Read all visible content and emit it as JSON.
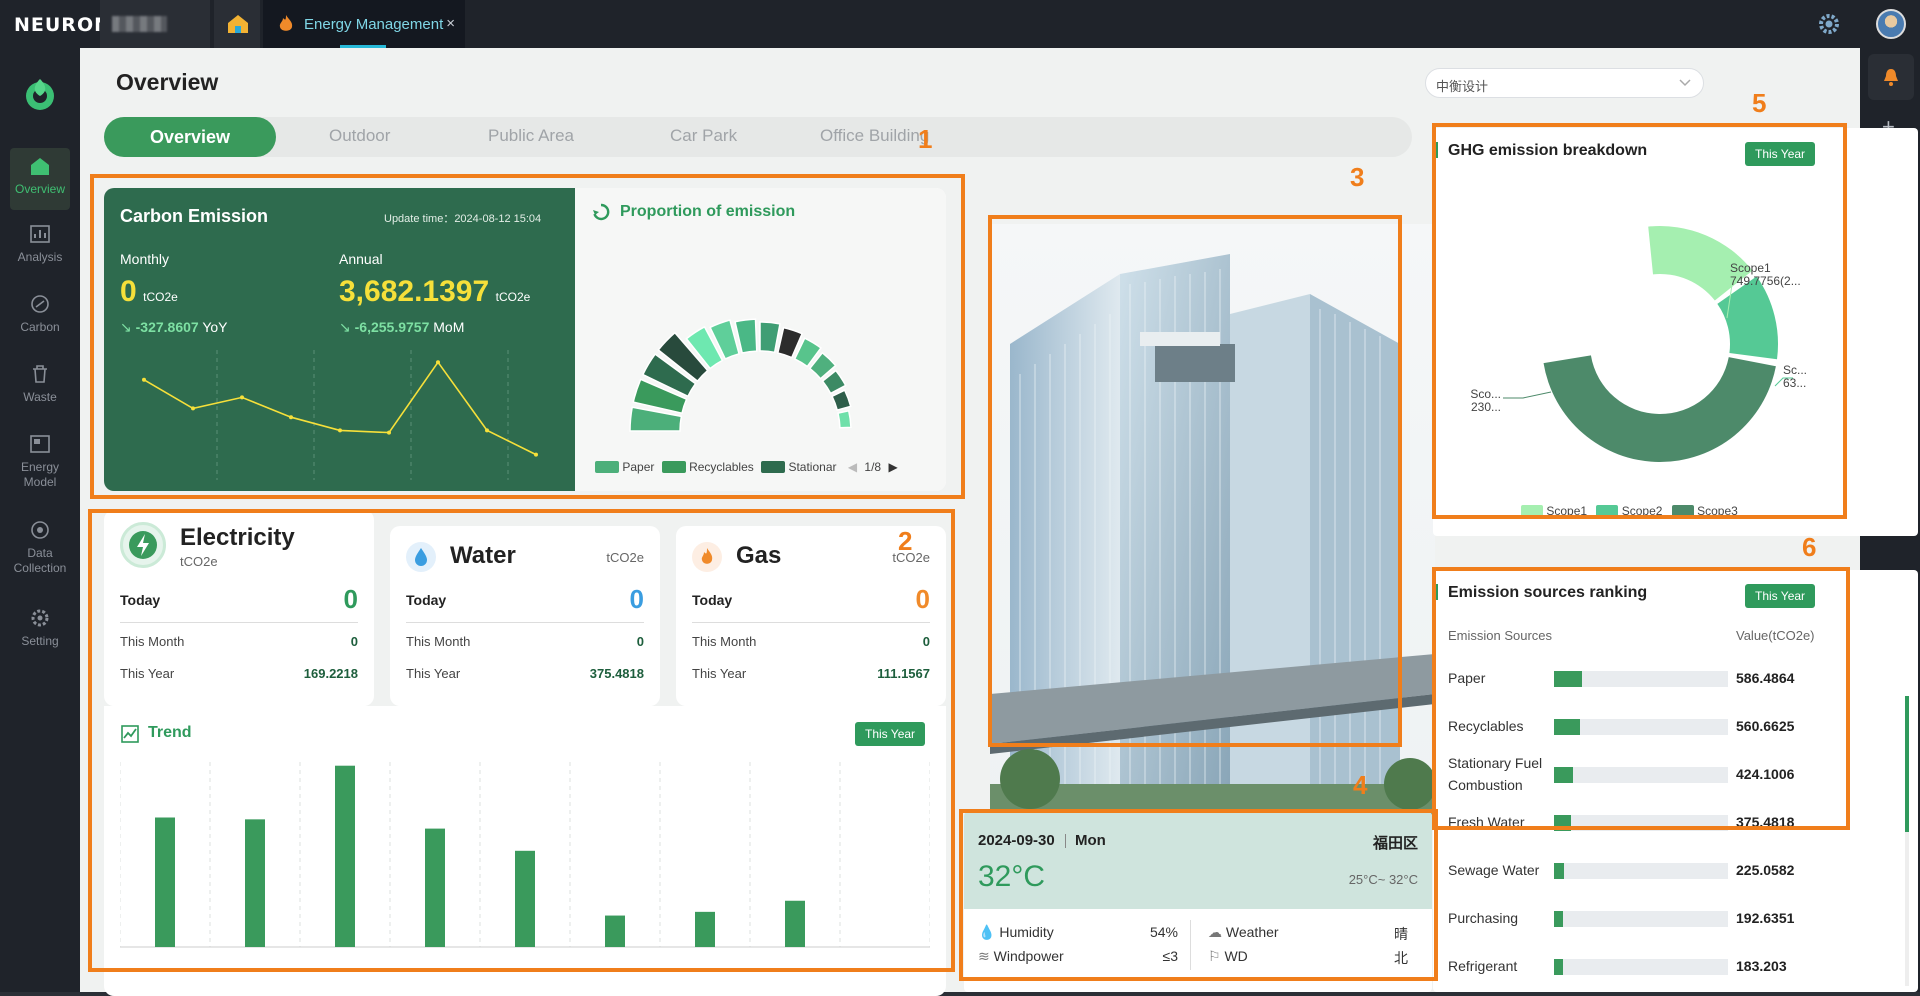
{
  "app": {
    "logo": "NEURON",
    "tab_title": "Energy Management",
    "tab_close": "×"
  },
  "sidebar": {
    "items": [
      {
        "label": "Overview",
        "icon": "home-icon"
      },
      {
        "label": "Analysis",
        "icon": "analysis-icon"
      },
      {
        "label": "Carbon",
        "icon": "carbon-icon"
      },
      {
        "label": "Waste",
        "icon": "waste-icon"
      },
      {
        "label": "Energy Model",
        "icon": "energy-model-icon"
      },
      {
        "label": "Data Collection",
        "icon": "data-collection-icon"
      },
      {
        "label": "Setting",
        "icon": "setting-icon"
      }
    ]
  },
  "page": {
    "title": "Overview",
    "project_select": "中衡设计"
  },
  "nav_tabs": [
    "Overview",
    "Outdoor",
    "Public Area",
    "Car Park",
    "Office Building"
  ],
  "carbon": {
    "title": "Carbon Emission",
    "update_label": "Update time：",
    "update_time": "2024-08-12 15:04",
    "monthly_label": "Monthly",
    "monthly_value": "0",
    "unit": "tCO2e",
    "monthly_change": "-327.8607",
    "monthly_change_label": "YoY",
    "annual_label": "Annual",
    "annual_value": "3,682.1397",
    "annual_change": "-6,255.9757",
    "annual_change_label": "MoM",
    "sparkline": [
      820,
      560,
      660,
      480,
      360,
      340,
      980,
      360,
      140
    ]
  },
  "proportion": {
    "title": "Proportion of emission",
    "legend": [
      "Paper",
      "Recyclables",
      "Stationar"
    ],
    "page": "1/8",
    "colors": [
      "#4caf7a",
      "#3a9a5c",
      "#2e6b4e",
      "#284a3c",
      "#6ee8b0",
      "#5fcf9a",
      "#4ab886",
      "#3f9e74",
      "#2c2c2c",
      "#58c48c",
      "#4fb07e",
      "#3c8a64",
      "#2e5e4a",
      "#6fe0aa"
    ]
  },
  "electricity": {
    "title": "Electricity",
    "unit": "tCO2e",
    "today_label": "Today",
    "today": "0",
    "month_label": "This Month",
    "month": "0",
    "year_label": "This Year",
    "year": "169.2218"
  },
  "water": {
    "title": "Water",
    "unit": "tCO2e",
    "today_label": "Today",
    "today": "0",
    "month_label": "This Month",
    "month": "0",
    "year_label": "This Year",
    "year": "375.4818"
  },
  "gas": {
    "title": "Gas",
    "unit": "tCO2e",
    "today_label": "Today",
    "today": "0",
    "month_label": "This Month",
    "month": "0",
    "year_label": "This Year",
    "year": "111.1567"
  },
  "trend": {
    "title": "Trend",
    "period": "This Year",
    "values": [
      70,
      69,
      98,
      64,
      52,
      17,
      19,
      25
    ]
  },
  "weather": {
    "date": "2024-09-30",
    "weekday": "Mon",
    "district": "福田区",
    "temp": "32°C",
    "range": "25°C~ 32°C",
    "humidity_label": "Humidity",
    "humidity": "54%",
    "weather_label": "Weather",
    "weather": "晴",
    "wind_label": "Windpower",
    "wind": "≤3",
    "wd_label": "WD",
    "wd": "北"
  },
  "ghg": {
    "title": "GHG emission breakdown",
    "period": "This Year",
    "labels": {
      "scope1_a": "Scope1",
      "scope1_b": "749.7756(2...",
      "scope2_a": "Sc...",
      "scope2_b": "63...",
      "scope3_a": "Sco...",
      "scope3_b": "230..."
    },
    "legend": [
      "Scope1",
      "Scope2",
      "Scope3"
    ],
    "colors": [
      "#a5efb0",
      "#55c995",
      "#4d8a6a"
    ]
  },
  "ranking": {
    "title": "Emission sources ranking",
    "period": "This Year",
    "col_source": "Emission Sources",
    "col_value": "Value(tCO2e)",
    "rows": [
      {
        "name": "Paper",
        "value": "586.4864",
        "pct": 0.16
      },
      {
        "name": "Recyclables",
        "value": "560.6625",
        "pct": 0.15
      },
      {
        "name": "Stationary Fuel Combustion",
        "value": "424.1006",
        "pct": 0.11
      },
      {
        "name": "Fresh Water",
        "value": "375.4818",
        "pct": 0.1
      },
      {
        "name": "Sewage Water",
        "value": "225.0582",
        "pct": 0.06
      },
      {
        "name": "Purchasing",
        "value": "192.6351",
        "pct": 0.05
      },
      {
        "name": "Refrigerant",
        "value": "183.203",
        "pct": 0.05
      }
    ]
  },
  "annotations": [
    "1",
    "2",
    "3",
    "4",
    "5",
    "6"
  ]
}
